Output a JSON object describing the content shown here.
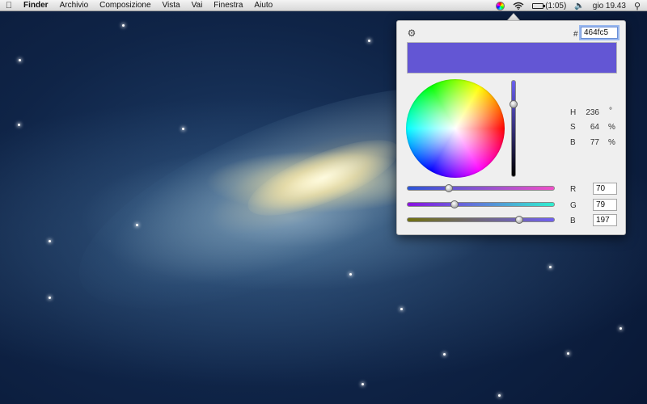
{
  "menubar": {
    "apple_icon": "",
    "items": [
      "Finder",
      "Archivio",
      "Composizione",
      "Vista",
      "Vai",
      "Finestra",
      "Aiuto"
    ],
    "battery_text": "(1:05)",
    "clock": "gio 19.43"
  },
  "picker": {
    "hex_label": "#",
    "hex_value": "464fc5",
    "swatch_color": "#6356d4",
    "hsb": {
      "h_label": "H",
      "h_value": "236",
      "h_unit": "°",
      "s_label": "S",
      "s_value": "64",
      "s_unit": "%",
      "b_label": "B",
      "b_value": "77",
      "b_unit": "%"
    },
    "brightness_fraction": 0.77,
    "rgb": {
      "r_label": "R",
      "r_value": "70",
      "g_label": "G",
      "g_value": "79",
      "b_label": "B",
      "b_value": "197"
    },
    "slider_levels": {
      "r": 70,
      "g": 79,
      "b": 197,
      "max": 255
    },
    "track_colors": {
      "r": [
        "#2a55d6",
        "#f050c8"
      ],
      "g": [
        "#8a10e0",
        "#30f0d0"
      ],
      "b": [
        "#707010",
        "#7060f0"
      ]
    }
  }
}
